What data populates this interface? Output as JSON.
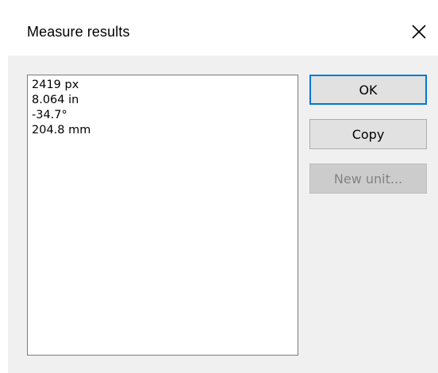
{
  "window": {
    "title": "Measure results",
    "close_icon": "close-icon"
  },
  "results": {
    "lines": [
      "2419 px",
      "8.064 in",
      "-34.7°",
      "204.8 mm"
    ]
  },
  "buttons": {
    "ok_label": "OK",
    "copy_label": "Copy",
    "new_unit_label": "New unit..."
  },
  "colors": {
    "default_button_border": "#0078d7",
    "dialog_background": "#f0f0f0",
    "disabled_text": "#838383"
  }
}
